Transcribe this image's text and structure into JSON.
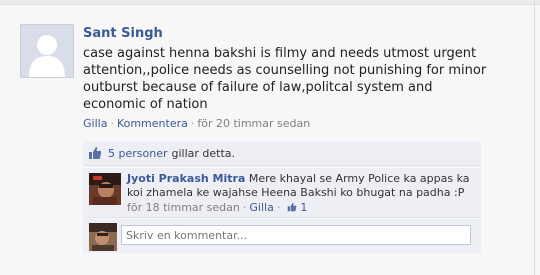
{
  "post": {
    "author": "Sant Singh",
    "message": "case against henna bakshi is filmy and needs utmost urgent\nattention,,police needs as counselling not punishing for minor\noutburst because of failure of law,politcal system and\neconomic of nation",
    "like_label": "Gilla",
    "comment_label": "Kommentera",
    "timestamp": "för 20 timmar sedan"
  },
  "likes": {
    "count": "5 personer",
    "text": "gillar detta."
  },
  "comments": [
    {
      "author": "Jyoti Prakash Mitra",
      "text": "Mere khayal se Army Police ka appas ka koi zhamela ke wajahse Heena Bakshi ko bhugat na padha :P",
      "timestamp": "för 18 timmar sedan",
      "like_label": "Gilla",
      "like_count": "1"
    }
  ],
  "composer": {
    "placeholder": "Skriv en kommentar..."
  },
  "colors": {
    "link": "#3b5998",
    "panel": "#edeff4",
    "border": "#dfe3ee"
  }
}
